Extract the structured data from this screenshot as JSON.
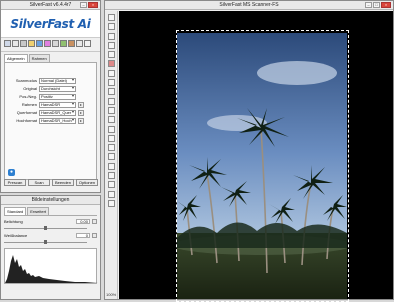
{
  "left_window": {
    "title": "SilverFast v6.4.4r7",
    "logo": "SilverFast Ai",
    "tabs": [
      "Allgemein",
      "Rahmen"
    ],
    "settings": [
      {
        "label": "Scanmodus",
        "value": "Normal (Datei)"
      },
      {
        "label": "Original",
        "value": "Durchsicht"
      },
      {
        "label": "Pos./Neg.",
        "value": "Positiv"
      },
      {
        "label": "Rahmen",
        "value": "HamaDSR"
      },
      {
        "label": "Querformat",
        "value": "HamaDSR_Quer"
      },
      {
        "label": "Hochformat",
        "value": "HamaDSR_Hoch"
      }
    ],
    "buttons": [
      "Prescan",
      "Scan",
      "Beenden",
      "Optionen"
    ]
  },
  "bottom_left_window": {
    "title": "Bildeinstellungen",
    "tabs": [
      "Standard",
      "Erweitert"
    ],
    "belichtung": {
      "label": "Belichtung",
      "value": "0.00"
    },
    "weissbalance": {
      "label": "Weißbalance",
      "value": "0"
    }
  },
  "scanner_window": {
    "title": "SilverFast MS Scanner-FS",
    "zoom": "100%"
  },
  "colors": {
    "accent": "#1f5fb0",
    "close": "#d9453b"
  }
}
